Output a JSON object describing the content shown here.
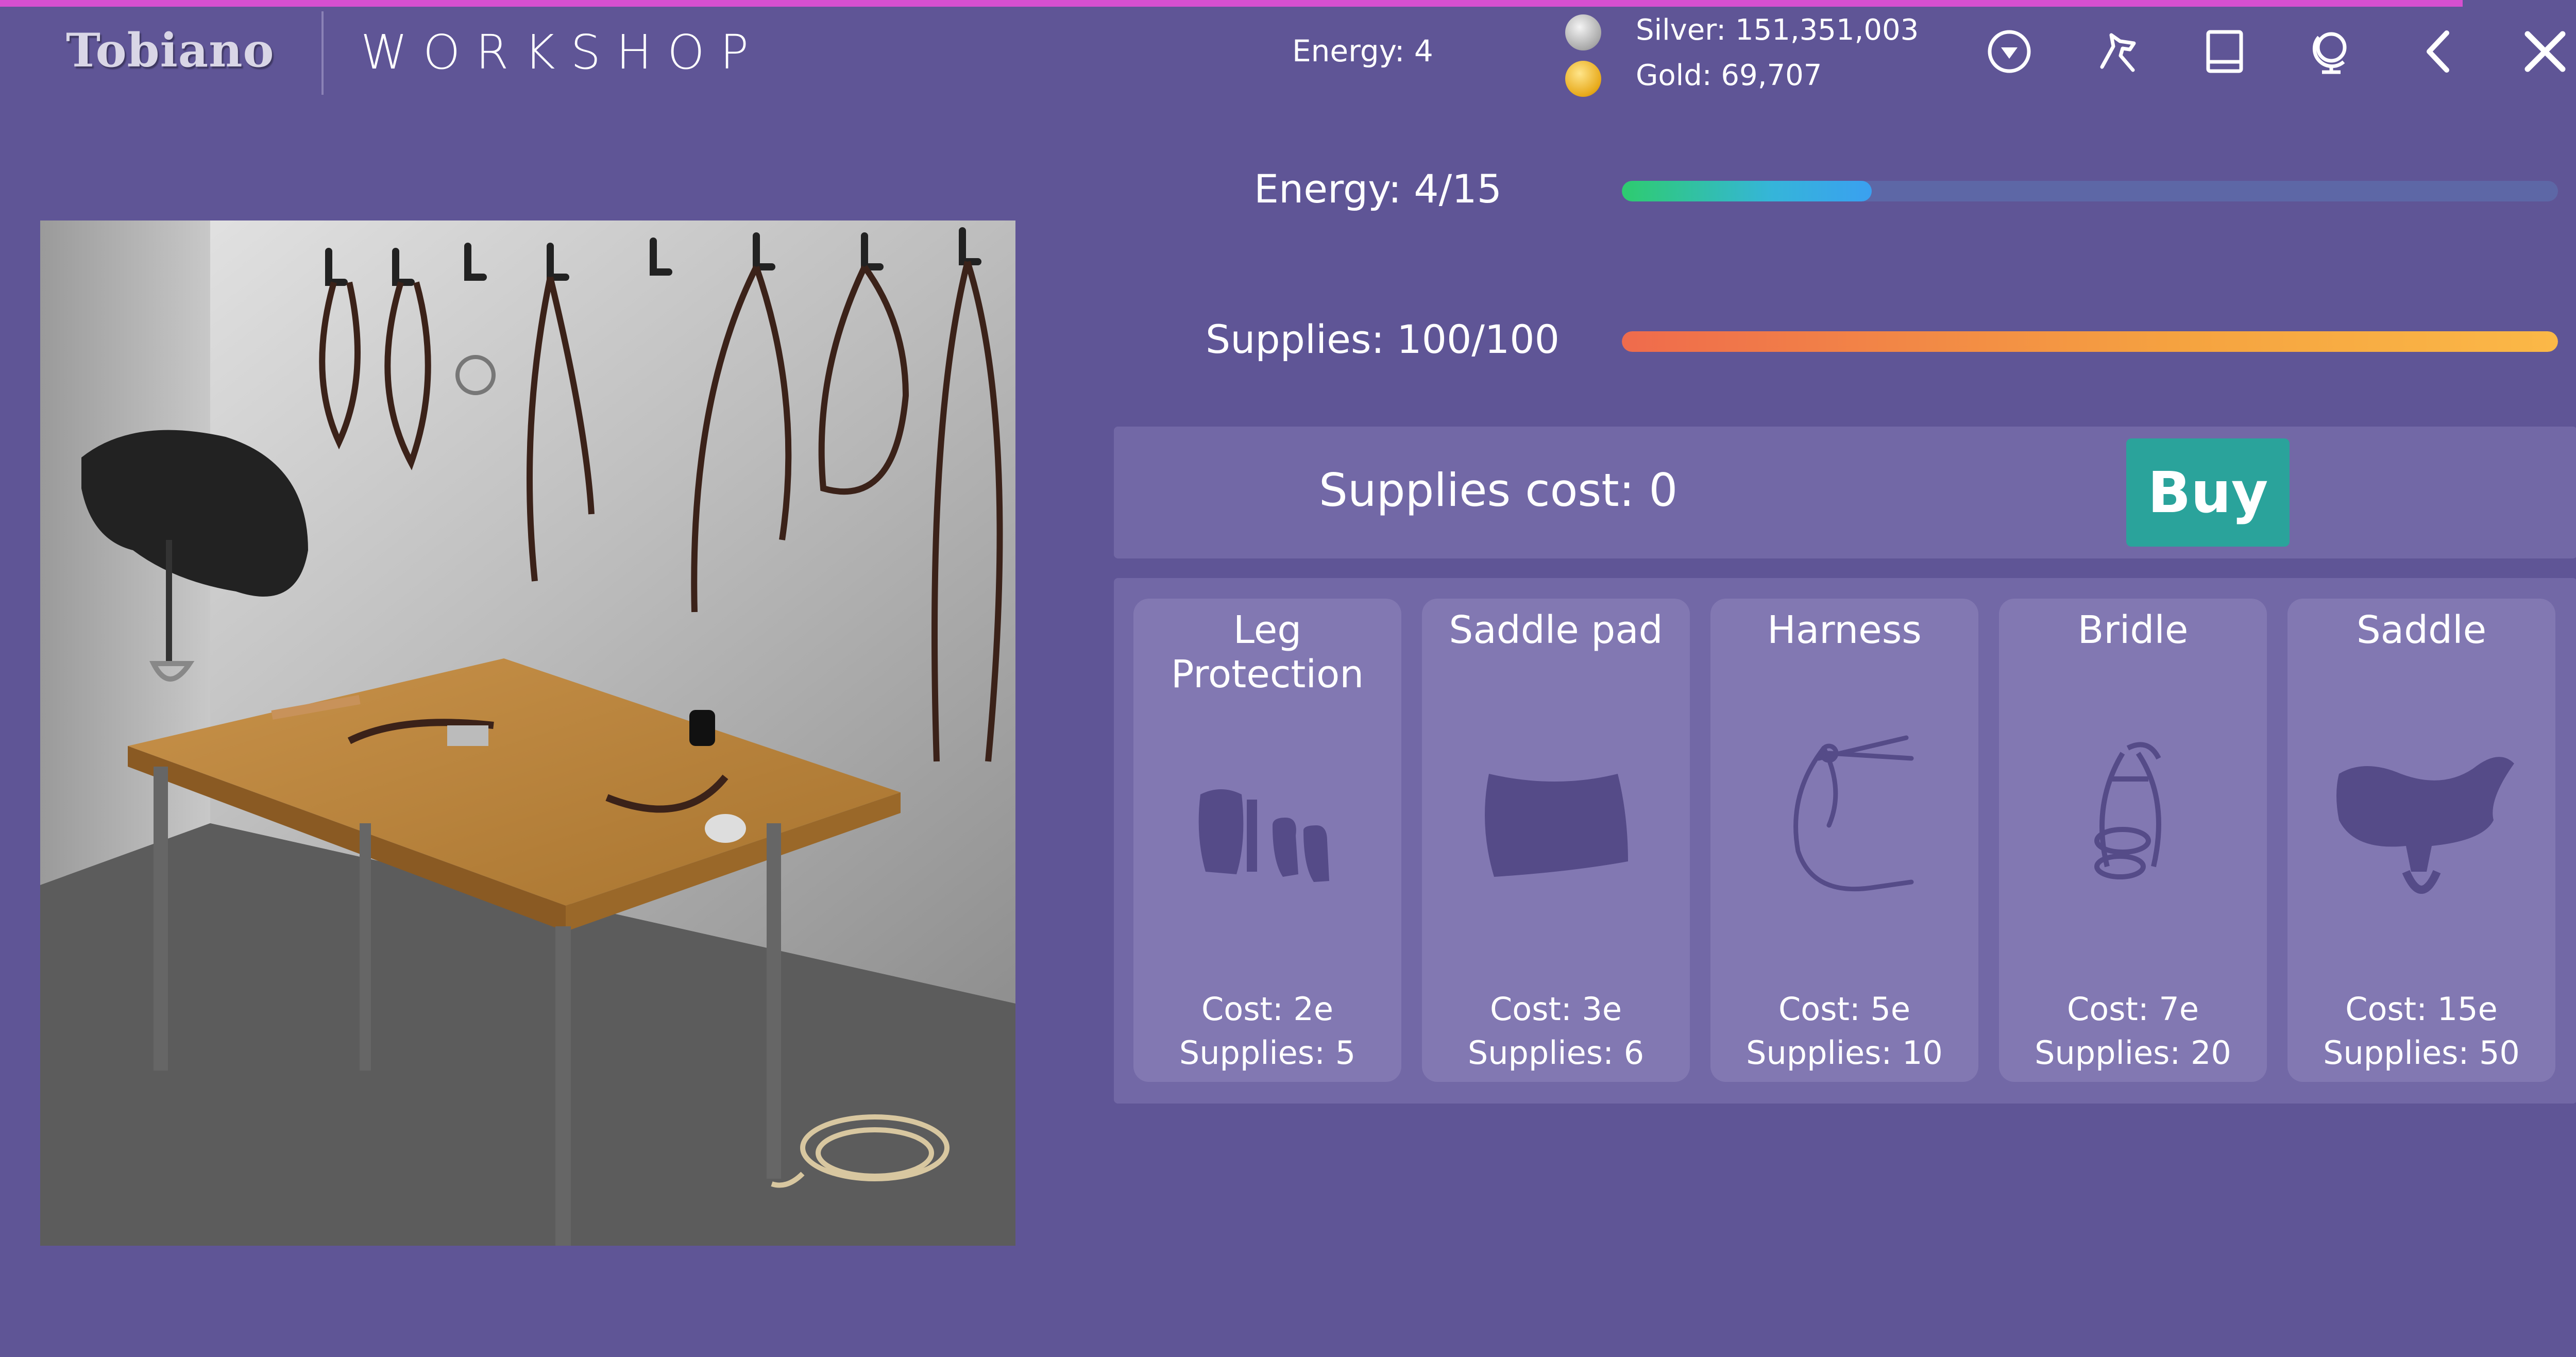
{
  "header": {
    "logo": "Tobiano",
    "title": "WORKSHOP",
    "energy_label": "Energy: 4",
    "silver_label": "Silver: 151,351,003",
    "gold_label": "Gold: 69,707",
    "icons": [
      "dropdown-circle-icon",
      "horse-icon",
      "book-icon",
      "globe-icon",
      "back-chevron-icon",
      "close-icon"
    ]
  },
  "energy_bar": {
    "label": "Energy: 4/15",
    "value": 4,
    "max": 15,
    "fill_fraction": 0.2667
  },
  "supplies_bar": {
    "label": "Supplies: 100/100",
    "value": 100,
    "max": 100,
    "fill_fraction": 1.0
  },
  "shop": {
    "supplies_cost_label": "Supplies cost: 0",
    "buy_label": "Buy"
  },
  "items": [
    {
      "name": "Leg Protection",
      "cost": "Cost: 2e",
      "supplies": "Supplies: 5",
      "icon": "leg-protection-icon"
    },
    {
      "name": "Saddle pad",
      "cost": "Cost: 3e",
      "supplies": "Supplies: 6",
      "icon": "saddle-pad-icon"
    },
    {
      "name": "Harness",
      "cost": "Cost: 5e",
      "supplies": "Supplies: 10",
      "icon": "harness-icon"
    },
    {
      "name": "Bridle",
      "cost": "Cost: 7e",
      "supplies": "Supplies: 20",
      "icon": "bridle-icon"
    },
    {
      "name": "Saddle",
      "cost": "Cost: 15e",
      "supplies": "Supplies: 50",
      "icon": "saddle-icon"
    }
  ],
  "colors": {
    "background": "#5f5596",
    "panel": "#7268a6",
    "card": "#8278b2",
    "buy_button": "#2aa39b",
    "top_accent": "#d64fd0"
  }
}
